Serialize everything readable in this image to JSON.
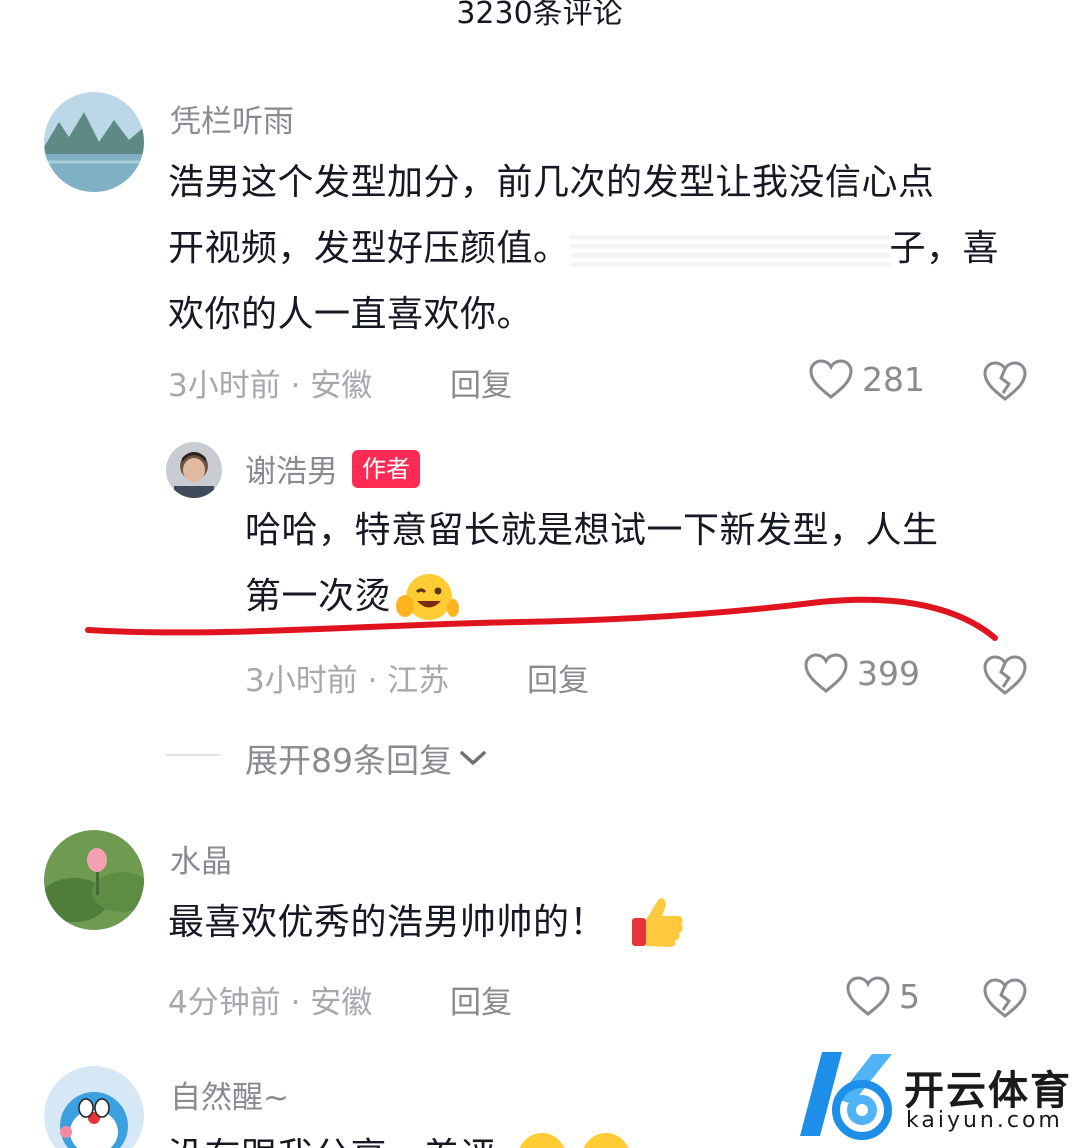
{
  "header": {
    "title": "3230条评论"
  },
  "comments": [
    {
      "username": "凭栏听雨",
      "text_line1": "浩男这个发型加分，前几次的发型让我没信心点",
      "text_line2_a": "开视频，发型好压颜值。",
      "text_line2_b": "子，喜",
      "text_line3": "欢你的人一直喜欢你。",
      "meta": "3小时前 · 安徽",
      "reply_label": "回复",
      "likes": "281"
    },
    {
      "username": "水晶",
      "text": "最喜欢优秀的浩男帅帅的！",
      "meta": "4分钟前 · 安徽",
      "reply_label": "回复",
      "likes": "5"
    },
    {
      "username": "自然醒~",
      "text": "没有跟我分享，差评"
    }
  ],
  "author_reply": {
    "username": "谢浩男",
    "badge": "作者",
    "text_line1": "哈哈，特意留长就是想试一下新发型，人生",
    "text_line2": "第一次烫",
    "meta": "3小时前 · 江苏",
    "reply_label": "回复",
    "likes": "399"
  },
  "expand": {
    "label": "展开89条回复"
  },
  "watermark": {
    "name_cn": "开云体育",
    "name_en": "kaiyun.com"
  },
  "colors": {
    "accent": "#fe2c55",
    "annotation": "#e0141e",
    "watermark_blue": "#1d8fe8"
  }
}
